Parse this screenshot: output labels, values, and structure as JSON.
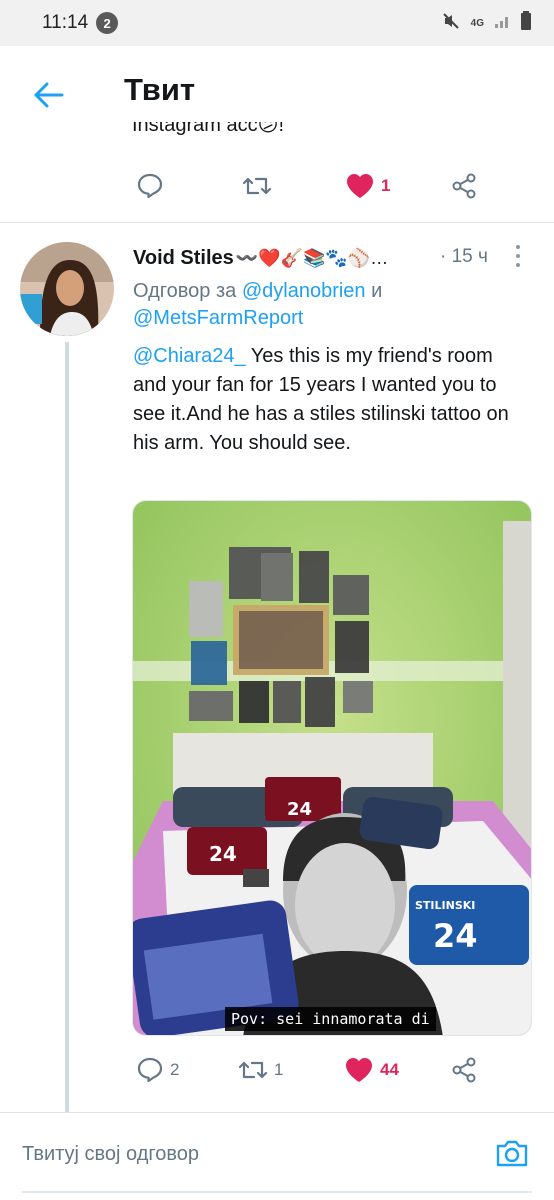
{
  "status_bar": {
    "time": "11:14",
    "notification_count": "2",
    "network": "4G"
  },
  "header": {
    "title": "Твит"
  },
  "previous_tweet": {
    "visible_text": "Instagram acc😕!",
    "like_count": "1"
  },
  "tweet": {
    "author_name": "Void Stiles",
    "author_emoji": "〰️❤️🎸📚🐾⚾…",
    "timestamp": "· 15 ч",
    "reply_prefix": "Одговор за",
    "reply_conjunction": "и",
    "reply_mention_1": "@dylanobrien",
    "reply_mention_2": "@MetsFarmReport",
    "text_mention": "@Chiara24_",
    "text_body": " Yes this is my friend's room and your fan for 15 years I wanted you to see it.And he has a stiles stilinski tattoo on his arm. You should see.",
    "media_caption": "Pov: sei innamorata di",
    "media_jersey_number": "24",
    "media_jersey_name": "STILINSKI",
    "reply_count": "2",
    "retweet_count": "1",
    "like_count": "44"
  },
  "composer": {
    "placeholder": "Твитуј свој одговор"
  },
  "colors": {
    "accent": "#1da1f2",
    "like": "#e0245e",
    "muted": "#657786",
    "icon": "#657786"
  },
  "icons": [
    "back-arrow-icon",
    "reply-icon",
    "retweet-icon",
    "heart-icon",
    "share-icon",
    "more-icon",
    "camera-icon",
    "mute-icon",
    "signal-icon",
    "battery-icon"
  ]
}
